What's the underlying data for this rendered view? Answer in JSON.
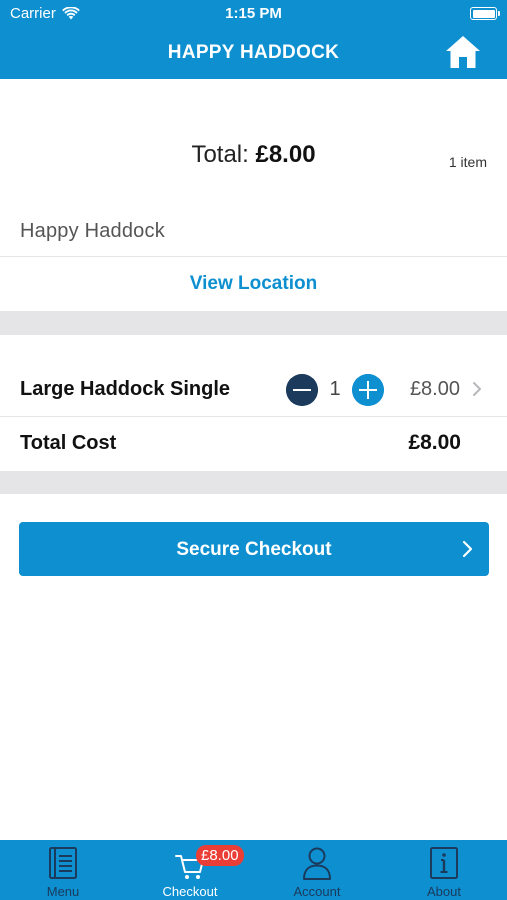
{
  "status_bar": {
    "carrier": "Carrier",
    "time": "1:15 PM"
  },
  "nav": {
    "title": "HAPPY HADDOCK",
    "home_icon": "home-icon"
  },
  "summary": {
    "total_label": "Total:",
    "total_value": "£8.00",
    "item_count": "1 item"
  },
  "restaurant": {
    "name": "Happy Haddock",
    "view_location": "View Location"
  },
  "cart": {
    "items": [
      {
        "name": "Large Haddock Single",
        "quantity": "1",
        "price": "£8.00"
      }
    ],
    "total_cost_label": "Total Cost",
    "total_cost_value": "£8.00"
  },
  "checkout_button": {
    "label": "Secure Checkout"
  },
  "tab_bar": {
    "tabs": [
      {
        "label": "Menu",
        "icon": "menu-book-icon"
      },
      {
        "label": "Checkout",
        "icon": "cart-icon",
        "badge": "£8.00",
        "active": true
      },
      {
        "label": "Account",
        "icon": "account-icon"
      },
      {
        "label": "About",
        "icon": "info-icon"
      }
    ]
  },
  "colors": {
    "brand": "#0d8fd0",
    "dark_navy": "#1b3a5c",
    "badge": "#ea3d35",
    "separator": "#e5e5e8"
  }
}
